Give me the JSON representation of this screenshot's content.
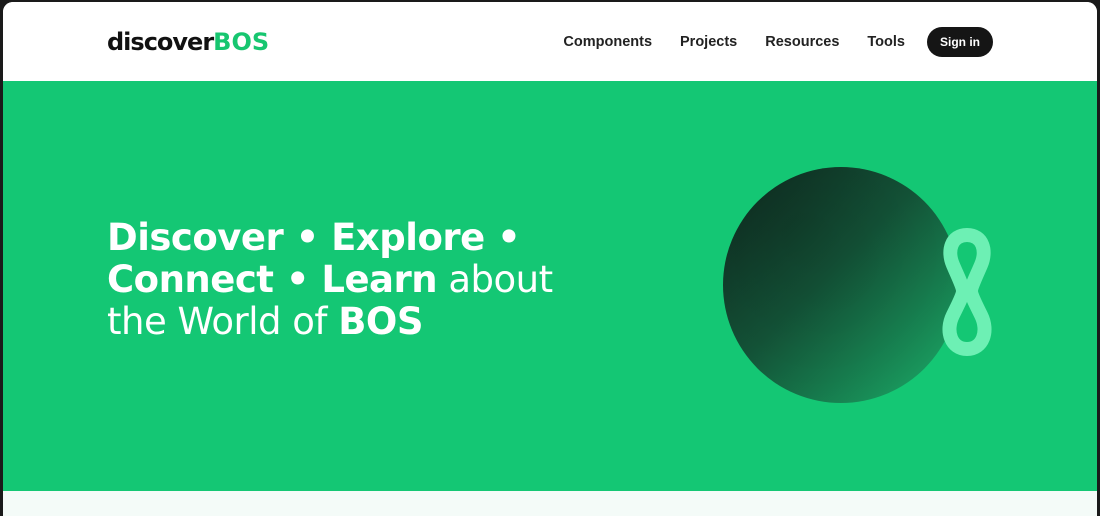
{
  "header": {
    "logo": {
      "part1": "discover",
      "part2": "BOS"
    },
    "nav": [
      {
        "label": "Components"
      },
      {
        "label": "Projects"
      },
      {
        "label": "Resources"
      },
      {
        "label": "Tools"
      }
    ],
    "signin_label": "Sign in"
  },
  "hero": {
    "heading_parts": {
      "p1": "Discover • Explore •",
      "p2": "Connect • Learn",
      "p3": " about",
      "p4": "the World of ",
      "p5": "BOS"
    },
    "art_icon": "bos-logo-icon"
  },
  "colors": {
    "brand_green": "#14c774",
    "logo_green": "#17c670",
    "button_dark": "#151515",
    "mint": "#6df0b4"
  }
}
